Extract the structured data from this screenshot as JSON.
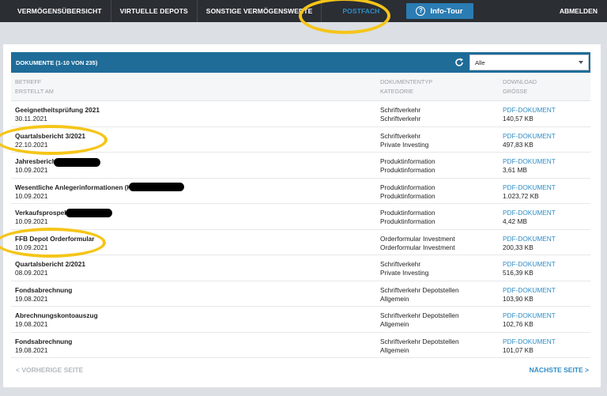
{
  "nav": {
    "items": [
      "VERMÖGENSÜBERSICHT",
      "VIRTUELLE DEPOTS",
      "SONSTIGE VERMÖGENSWERTE",
      "POSTFACH"
    ],
    "info_tour": "Info-Tour",
    "logout": "ABMELDEN"
  },
  "panel": {
    "title": "DOKUMENTE (1-10 VON 235)",
    "filter": "Alle"
  },
  "table": {
    "headers": {
      "col1_line1": "BETREFF",
      "col1_line2": "ERSTELLT AM",
      "col2_line1": "DOKUMENTENTYP",
      "col2_line2": "KATEGORIE",
      "col3_line1": "DOWNLOAD",
      "col3_line2": "GRÖSSE"
    },
    "rows": [
      {
        "subject": "Geeignetheitsprüfung 2021",
        "date": "30.11.2021",
        "type": "Schriftverkehr",
        "category": "Schriftverkehr",
        "download": "PDF-DOKUMENT",
        "size": "140,57 KB"
      },
      {
        "subject": "Quartalsbericht 3/2021",
        "date": "22.10.2021",
        "type": "Schriftverkehr",
        "category": "Private Investing",
        "download": "PDF-DOKUMENT",
        "size": "497,83 KB"
      },
      {
        "subject": "Jahresbericht",
        "date": "10.09.2021",
        "type": "Produktinformation",
        "category": "Produktinformation",
        "download": "PDF-DOKUMENT",
        "size": "3,61 MB"
      },
      {
        "subject": "Wesentliche Anlegerinformationen (KIID)",
        "date": "10.09.2021",
        "type": "Produktinformation",
        "category": "Produktinformation",
        "download": "PDF-DOKUMENT",
        "size": "1.023,72 KB"
      },
      {
        "subject": "Verkaufsprospekt",
        "date": "10.09.2021",
        "type": "Produktinformation",
        "category": "Produktinformation",
        "download": "PDF-DOKUMENT",
        "size": "4,42 MB"
      },
      {
        "subject": "FFB Depot Orderformular",
        "date": "10.09.2021",
        "type": "Orderformular Investment",
        "category": "Orderformular Investment",
        "download": "PDF-DOKUMENT",
        "size": "200,33 KB"
      },
      {
        "subject": "Quartalsbericht 2/2021",
        "date": "08.09.2021",
        "type": "Schriftverkehr",
        "category": "Private Investing",
        "download": "PDF-DOKUMENT",
        "size": "516,39 KB"
      },
      {
        "subject": "Fondsabrechnung",
        "date": "19.08.2021",
        "type": "Schriftverkehr Depotstellen",
        "category": "Allgemein",
        "download": "PDF-DOKUMENT",
        "size": "103,90 KB"
      },
      {
        "subject": "Abrechnungskontoauszug",
        "date": "19.08.2021",
        "type": "Schriftverkehr Depotstellen",
        "category": "Allgemein",
        "download": "PDF-DOKUMENT",
        "size": "102,76 KB"
      },
      {
        "subject": "Fondsabrechnung",
        "date": "19.08.2021",
        "type": "Schriftverkehr Depotstellen",
        "category": "Allgemein",
        "download": "PDF-DOKUMENT",
        "size": "101,07 KB"
      }
    ]
  },
  "pager": {
    "prev": "< VORHERIGE SEITE",
    "next": "NÄCHSTE SEITE >"
  },
  "colors": {
    "nav_bg": "#2b2e33",
    "accent": "#2f8dc5",
    "header_bar": "#1f6c99",
    "highlight": "#f5c518"
  }
}
